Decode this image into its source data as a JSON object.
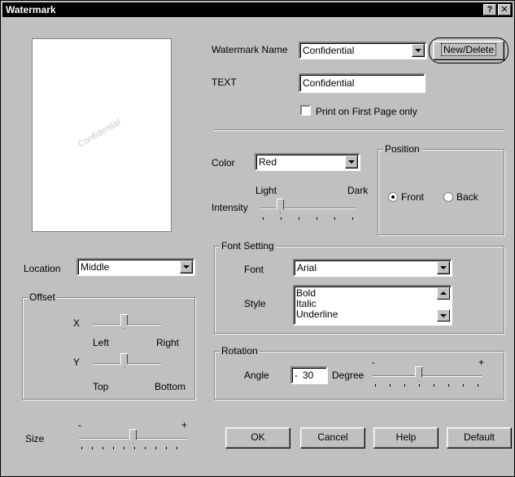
{
  "window": {
    "title": "Watermark",
    "help_label": "?",
    "close_label": "✕"
  },
  "preview": {
    "watermark_text": "Confidential"
  },
  "watermark_name": {
    "label": "Watermark Name",
    "value": "Confidential"
  },
  "new_delete_button": "New/Delete",
  "text_field": {
    "label": "TEXT",
    "value": "Confidential"
  },
  "first_page_only": {
    "label": "Print on First Page only",
    "checked": false
  },
  "color": {
    "label": "Color",
    "value": "Red"
  },
  "intensity": {
    "label": "Intensity",
    "light": "Light",
    "dark": "Dark",
    "level": 0.2
  },
  "position": {
    "title": "Position",
    "front": "Front",
    "back": "Back",
    "selected": "Front"
  },
  "location": {
    "label": "Location",
    "value": "Middle"
  },
  "offset": {
    "title": "Offset",
    "x_label": "X",
    "x_left": "Left",
    "x_right": "Right",
    "y_label": "Y",
    "y_top": "Top",
    "y_bottom": "Bottom"
  },
  "font_setting": {
    "title": "Font Setting",
    "font_label": "Font",
    "font_value": "Arial",
    "style_label": "Style",
    "styles": [
      "Bold",
      "Italic",
      "Underline"
    ]
  },
  "rotation": {
    "title": "Rotation",
    "angle_label": "Angle",
    "angle_sign": "-",
    "angle_value": "30",
    "degree_label": "Degree",
    "minus": "-",
    "plus": "+"
  },
  "size": {
    "label": "Size",
    "minus": "-",
    "plus": "+"
  },
  "buttons": {
    "ok": "OK",
    "cancel": "Cancel",
    "help": "Help",
    "default": "Default"
  },
  "colors": {
    "titlebar": "#000000",
    "face": "#c0c0c0"
  }
}
